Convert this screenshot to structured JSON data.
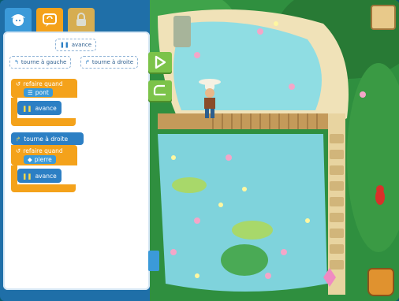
{
  "palette": {
    "avance": "avance",
    "tourne_gauche": "tourne à gauche",
    "tourne_droite": "tourne à droite"
  },
  "program": {
    "loop1_label": "refaire quand",
    "loop1_condition": "pont",
    "loop1_body": "avance",
    "turn": "tourne à droite",
    "loop2_label": "refaire quand",
    "loop2_condition": "pierre",
    "loop2_body": "avance"
  },
  "colors": {
    "accent_orange": "#f4a21b",
    "accent_blue": "#2c7fc4",
    "play_green": "#7cc34a",
    "water": "#7fd3dc",
    "sand": "#f0e2b8",
    "jungle": "#2f8f3f"
  },
  "icons": [
    "avatar-icon",
    "code-icon",
    "lock-icon",
    "play-icon",
    "reset-icon",
    "map-scroll-icon",
    "backpack-icon"
  ]
}
